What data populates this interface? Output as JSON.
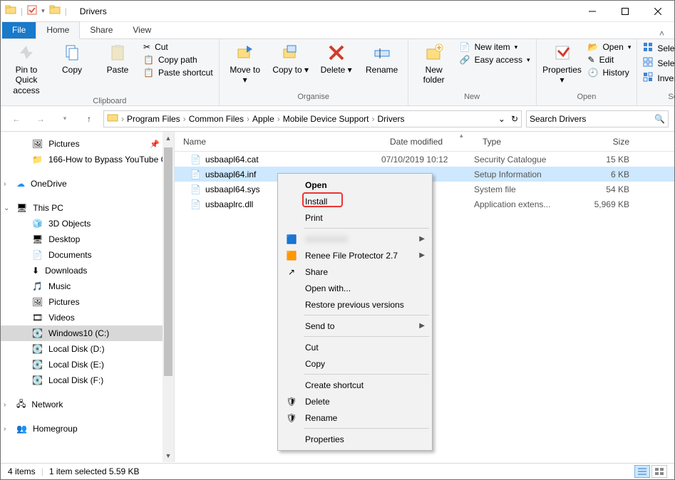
{
  "window": {
    "title": "Drivers"
  },
  "qat": {
    "drop": "▾"
  },
  "tabs": {
    "file": "File",
    "home": "Home",
    "share": "Share",
    "view": "View"
  },
  "ribbon": {
    "pin": "Pin to Quick access",
    "copy": "Copy",
    "paste": "Paste",
    "cut": "Cut",
    "copypath": "Copy path",
    "pasteshortcut": "Paste shortcut",
    "group_clipboard": "Clipboard",
    "moveto": "Move to",
    "copyto": "Copy to",
    "delete": "Delete",
    "rename": "Rename",
    "group_organise": "Organise",
    "newfolder": "New folder",
    "newitem": "New item",
    "easyaccess": "Easy access",
    "group_new": "New",
    "properties": "Properties",
    "open": "Open",
    "edit": "Edit",
    "history": "History",
    "group_open": "Open",
    "selectall": "Select all",
    "selectnone": "Select none",
    "invert": "Invert selection",
    "group_select": "Select"
  },
  "breadcrumb": [
    "Program Files",
    "Common Files",
    "Apple",
    "Mobile Device Support",
    "Drivers"
  ],
  "search": {
    "placeholder": "Search Drivers"
  },
  "columns": {
    "name": "Name",
    "date": "Date modified",
    "type": "Type",
    "size": "Size"
  },
  "nav": {
    "pictures": "Pictures",
    "bypass": "166-How to Bypass YouTube C",
    "onedrive": "OneDrive",
    "thispc": "This PC",
    "objects3d": "3D Objects",
    "desktop": "Desktop",
    "documents": "Documents",
    "downloads": "Downloads",
    "music": "Music",
    "picfolder": "Pictures",
    "videos": "Videos",
    "win10": "Windows10 (C:)",
    "locald": "Local Disk (D:)",
    "locale": "Local Disk (E:)",
    "localf": "Local Disk (F:)",
    "network": "Network",
    "homegroup": "Homegroup"
  },
  "files": [
    {
      "name": "usbaapl64.cat",
      "date": "07/10/2019 10:12",
      "type": "Security Catalogue",
      "size": "15 KB",
      "selected": false
    },
    {
      "name": "usbaapl64.inf",
      "date": "",
      "type": "Setup Information",
      "size": "6 KB",
      "selected": true
    },
    {
      "name": "usbaapl64.sys",
      "date": "",
      "type": "System file",
      "size": "54 KB",
      "selected": false
    },
    {
      "name": "usbaaplrc.dll",
      "date": "",
      "type": "Application extens...",
      "size": "5,969 KB",
      "selected": false
    }
  ],
  "context": {
    "open": "Open",
    "install": "Install",
    "print": "Print",
    "blurred": "",
    "renee": "Renee File Protector 2.7",
    "share": "Share",
    "openwith": "Open with...",
    "restore": "Restore previous versions",
    "sendto": "Send to",
    "cut": "Cut",
    "copy": "Copy",
    "shortcut": "Create shortcut",
    "delete": "Delete",
    "rename": "Rename",
    "properties": "Properties"
  },
  "status": {
    "items": "4 items",
    "selected": "1 item selected  5.59 KB"
  }
}
